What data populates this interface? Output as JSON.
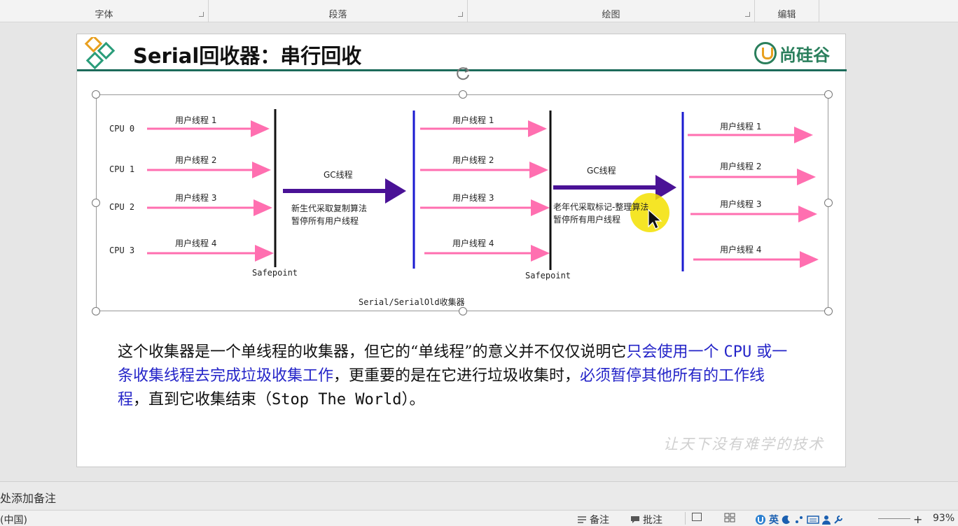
{
  "ribbon": {
    "groups": [
      {
        "label": "字体"
      },
      {
        "label": "段落"
      },
      {
        "label": "绘图"
      },
      {
        "label": "编辑"
      }
    ]
  },
  "slide": {
    "title": "Serial回收器：串行回收",
    "brand": "尚硅谷",
    "diagram": {
      "cpus": [
        "CPU 0",
        "CPU 1",
        "CPU 2",
        "CPU 3"
      ],
      "user_threads": [
        "用户线程 1",
        "用户线程 2",
        "用户线程 3",
        "用户线程 4"
      ],
      "gc_thread_label": "GC线程",
      "young_gc_note_1": "新生代采取复制算法",
      "young_gc_note_2": "暂停所有用户线程",
      "old_gc_note_1": "老年代采取标记-整理算法",
      "old_gc_note_2": "暂停所有用户线程",
      "safepoint": "Safepoint",
      "caption": "Serial/SerialOld收集器",
      "colors": {
        "user_arrow": "#ff6fb0",
        "gc_arrow": "#4a1296",
        "barrier_black": "#111111",
        "barrier_blue": "#1a1ad0"
      }
    },
    "body": {
      "s1": "这个收集器是一个单线程的收集器，但它的“单线程”的意义并不仅仅说明它",
      "s2": "只会使用一个 ",
      "s3": "CPU",
      "s4": " 或一条收集线程去完成垃圾收集工作",
      "s5": "，更重要的是在它进行垃圾收集时，",
      "s6": "必须暂停其他所有的工作线程",
      "s7": "，直到它收集结束（",
      "s8": "Stop The World",
      "s9": "）。"
    },
    "watermark": "让天下没有难学的技术"
  },
  "notes": {
    "placeholder": "处添加备注"
  },
  "status": {
    "language": "(中国)",
    "notes_btn": "备注",
    "comments_btn": "批注",
    "ime": "英",
    "zoom": "93%"
  }
}
